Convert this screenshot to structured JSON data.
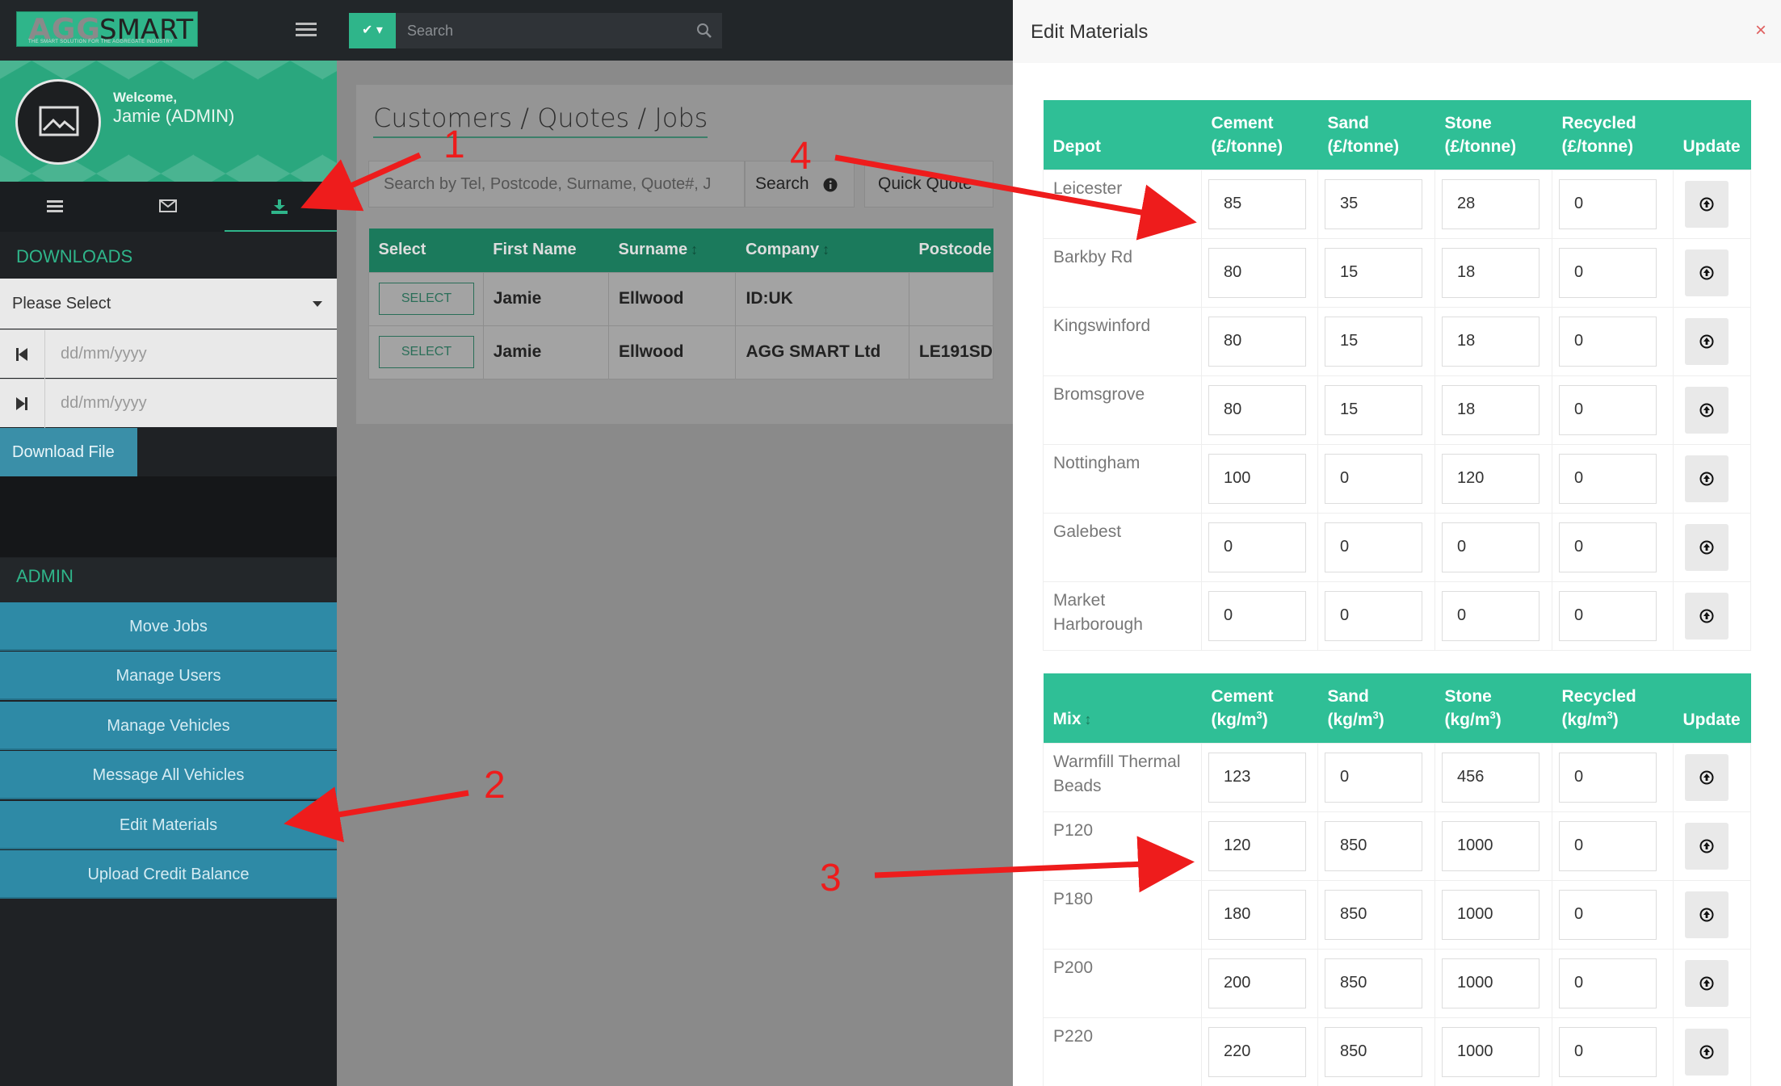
{
  "header": {
    "logo_main": "AGG",
    "logo_sub": "SMART",
    "logo_tagline": "THE SMART SOLUTION FOR THE AGGREGATE INDUSTRY",
    "search_placeholder": "Search"
  },
  "sidebar": {
    "welcome": "Welcome,",
    "user": "Jamie (ADMIN)",
    "downloads_title": "DOWNLOADS",
    "select_value": "Please Select",
    "date_from_placeholder": "dd/mm/yyyy",
    "date_to_placeholder": "dd/mm/yyyy",
    "download_label": "Download File",
    "admin_title": "ADMIN",
    "admin_items": [
      {
        "label": "Move Jobs"
      },
      {
        "label": "Manage Users"
      },
      {
        "label": "Manage Vehicles"
      },
      {
        "label": "Message All Vehicles"
      },
      {
        "label": "Edit Materials"
      },
      {
        "label": "Upload Credit Balance"
      }
    ]
  },
  "main": {
    "breadcrumb": "Customers / Quotes / Jobs",
    "search_placeholder": "Search by Tel, Postcode, Surname, Quote#, J",
    "search_label": "Search",
    "quick_quote_label": "Quick Quote",
    "columns": [
      "Select",
      "First Name",
      "Surname",
      "Company",
      "Postcode"
    ],
    "select_label": "SELECT",
    "rows": [
      {
        "first": "Jamie",
        "surname": "Ellwood",
        "company": "ID:UK",
        "postcode": ""
      },
      {
        "first": "Jamie",
        "surname": "Ellwood",
        "company": "AGG SMART Ltd",
        "postcode": "LE191SD"
      }
    ]
  },
  "modal": {
    "title": "Edit Materials",
    "close": "×",
    "depot_table": {
      "headers": {
        "depot": "Depot",
        "cement": "Cement",
        "cement_unit": "(£/tonne)",
        "sand": "Sand",
        "sand_unit": "(£/tonne)",
        "stone": "Stone",
        "stone_unit": "(£/tonne)",
        "recycled": "Recycled",
        "recycled_unit": "(£/tonne)",
        "update": "Update"
      },
      "rows": [
        {
          "name": "Leicester",
          "cement": "85",
          "sand": "35",
          "stone": "28",
          "recycled": "0"
        },
        {
          "name": "Barkby Rd",
          "cement": "80",
          "sand": "15",
          "stone": "18",
          "recycled": "0"
        },
        {
          "name": "Kingswinford",
          "cement": "80",
          "sand": "15",
          "stone": "18",
          "recycled": "0"
        },
        {
          "name": "Bromsgrove",
          "cement": "80",
          "sand": "15",
          "stone": "18",
          "recycled": "0"
        },
        {
          "name": "Nottingham",
          "cement": "100",
          "sand": "0",
          "stone": "120",
          "recycled": "0"
        },
        {
          "name": "Galebest",
          "cement": "0",
          "sand": "0",
          "stone": "0",
          "recycled": "0"
        },
        {
          "name": "Market Harborough",
          "cement": "0",
          "sand": "0",
          "stone": "0",
          "recycled": "0"
        }
      ]
    },
    "mix_table": {
      "headers": {
        "mix": "Mix",
        "cement": "Cement",
        "sand": "Sand",
        "stone": "Stone",
        "recycled": "Recycled",
        "unit_prefix": "(kg/m",
        "unit_power": "3",
        "unit_suffix": ")",
        "update": "Update"
      },
      "rows": [
        {
          "name": "Warmfill Thermal Beads",
          "cement": "123",
          "sand": "0",
          "stone": "456",
          "recycled": "0"
        },
        {
          "name": "P120",
          "cement": "120",
          "sand": "850",
          "stone": "1000",
          "recycled": "0"
        },
        {
          "name": "P180",
          "cement": "180",
          "sand": "850",
          "stone": "1000",
          "recycled": "0"
        },
        {
          "name": "P200",
          "cement": "200",
          "sand": "850",
          "stone": "1000",
          "recycled": "0"
        },
        {
          "name": "P220",
          "cement": "220",
          "sand": "850",
          "stone": "1000",
          "recycled": "0"
        }
      ]
    }
  },
  "annotations": {
    "n1": "1",
    "n2": "2",
    "n3": "3",
    "n4": "4",
    "color": "#ee1c1c"
  },
  "colors": {
    "accent": "#2fbf96",
    "admin_button": "#2e8aa6",
    "sidebar": "#1f2225"
  }
}
